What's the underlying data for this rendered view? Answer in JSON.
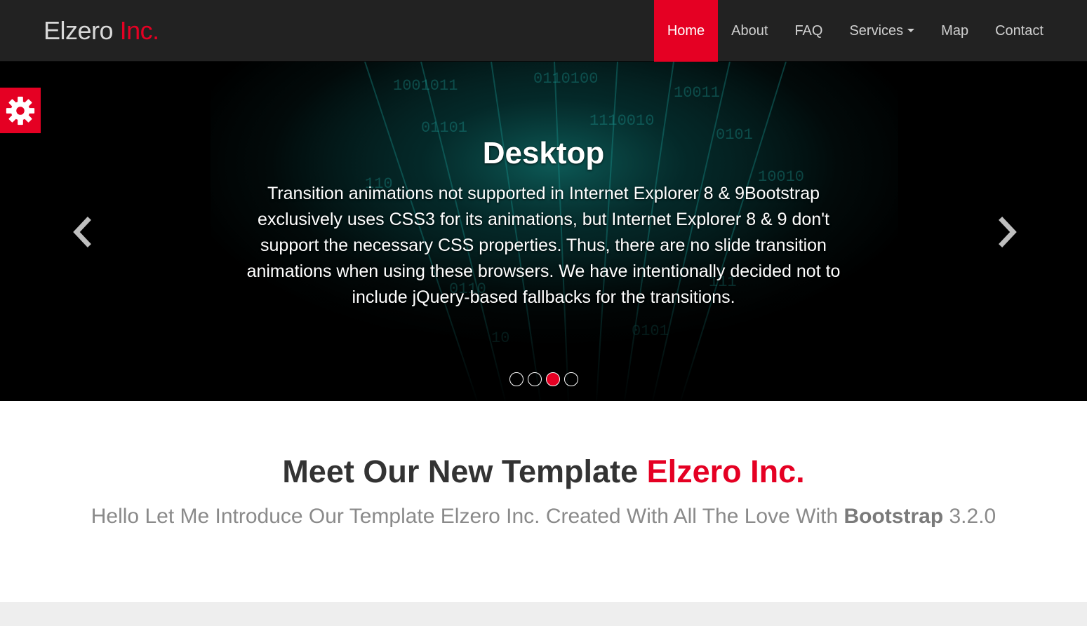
{
  "brand": {
    "name": "Elzero",
    "accent": "Inc."
  },
  "nav": {
    "items": [
      {
        "label": "Home",
        "active": true
      },
      {
        "label": "About"
      },
      {
        "label": "FAQ"
      },
      {
        "label": "Services",
        "dropdown": true
      },
      {
        "label": "Map"
      },
      {
        "label": "Contact"
      }
    ]
  },
  "settings": {
    "icon": "gear-icon"
  },
  "carousel": {
    "title": "Desktop",
    "text": "Transition animations not supported in Internet Explorer 8 & 9Bootstrap exclusively uses CSS3 for its animations, but Internet Explorer 8 & 9 don't support the necessary CSS properties. Thus, there are no slide transition animations when using these browsers. We have intentionally decided not to include jQuery-based fallbacks for the transitions.",
    "prev_icon": "chevron-left-icon",
    "next_icon": "chevron-right-icon",
    "slide_count": 4,
    "active_index": 2
  },
  "intro": {
    "title_main": "Meet Our New Template",
    "title_accent": "Elzero Inc.",
    "subtitle_pre": "Hello Let Me Introduce Our Template Elzero Inc. Created With All The Love With",
    "subtitle_bold": "Bootstrap",
    "subtitle_post": "3.2.0"
  },
  "colors": {
    "accent": "#e50023",
    "navbar_bg": "#222222",
    "nav_text": "#d0d0d0"
  }
}
